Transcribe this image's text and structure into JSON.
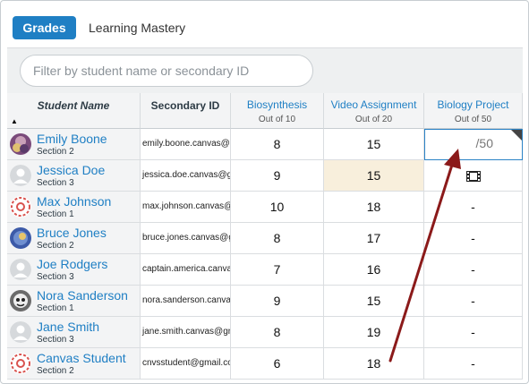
{
  "tabs": {
    "active": "Grades",
    "inactive": "Learning Mastery"
  },
  "filter": {
    "placeholder": "Filter by student name or secondary ID"
  },
  "headers": {
    "student": "Student Name",
    "secondary": "Secondary ID",
    "a1": {
      "title": "Biosynthesis",
      "sub": "Out of 10"
    },
    "a2": {
      "title": "Video Assignment",
      "sub": "Out of 20"
    },
    "a3": {
      "title": "Biology Project",
      "sub": "Out of 50"
    }
  },
  "colors": {
    "accent": "#1f7fc4",
    "highlight": "#f8efdc",
    "arrow": "#8b1a1a"
  },
  "rows": [
    {
      "name": "Emily Boone",
      "section": "Section 2",
      "sid": "emily.boone.canvas@g",
      "s1": "8",
      "s2": "15",
      "s3": "/50",
      "avatar": "photo-avatar"
    },
    {
      "name": "Jessica Doe",
      "section": "Section 3",
      "sid": "jessica.doe.canvas@g",
      "s1": "9",
      "s2": "15",
      "s3": "",
      "avatar": "default-avatar"
    },
    {
      "name": "Max Johnson",
      "section": "Section 1",
      "sid": "max.johnson.canvas@",
      "s1": "10",
      "s2": "18",
      "s3": "-",
      "avatar": "badge-avatar"
    },
    {
      "name": "Bruce Jones",
      "section": "Section 2",
      "sid": "bruce.jones.canvas@g",
      "s1": "8",
      "s2": "17",
      "s3": "-",
      "avatar": "photo-avatar"
    },
    {
      "name": "Joe Rodgers",
      "section": "Section 3",
      "sid": "captain.america.canva",
      "s1": "7",
      "s2": "16",
      "s3": "-",
      "avatar": "default-avatar"
    },
    {
      "name": "Nora Sanderson",
      "section": "Section 1",
      "sid": "nora.sanderson.canva",
      "s1": "9",
      "s2": "15",
      "s3": "-",
      "avatar": "photo-avatar"
    },
    {
      "name": "Jane Smith",
      "section": "Section 3",
      "sid": "jane.smith.canvas@gn",
      "s1": "8",
      "s2": "19",
      "s3": "-",
      "avatar": "default-avatar"
    },
    {
      "name": "Canvas Student",
      "section": "Section 2",
      "sid": "cnvsstudent@gmail.co",
      "s1": "6",
      "s2": "18",
      "s3": "-",
      "avatar": "badge-avatar"
    }
  ]
}
